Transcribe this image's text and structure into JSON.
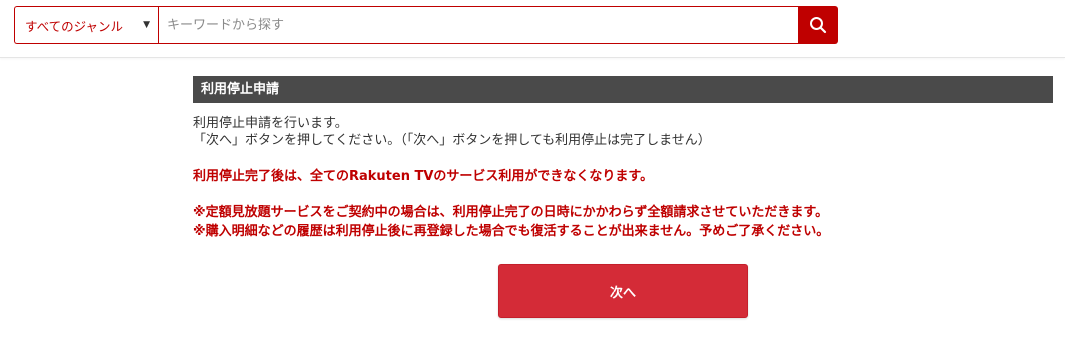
{
  "search": {
    "genre_label": "すべてのジャンル",
    "keyword_placeholder": "キーワードから探す",
    "search_icon": "search-icon"
  },
  "section": {
    "title": "利用停止申請",
    "desc_line1": "利用停止申請を行います。",
    "desc_line2": "「次へ」ボタンを押してください。（「次へ」ボタンを押しても利用停止は完了しません）",
    "warning": "利用停止完了後は、全てのRakuten TVのサービス利用ができなくなります。",
    "note1": "※定額見放題サービスをご契約中の場合は、利用停止完了の日時にかかわらず全額請求させていただきます。",
    "note2": "※購入明細などの履歴は利用停止後に再登録した場合でも復活することが出来ません。予めご了承ください。"
  },
  "next_button": {
    "label": "次へ"
  },
  "colors": {
    "brand_red": "#bf0000",
    "button_red": "#d42b37",
    "header_gray": "#4a4a4a"
  }
}
